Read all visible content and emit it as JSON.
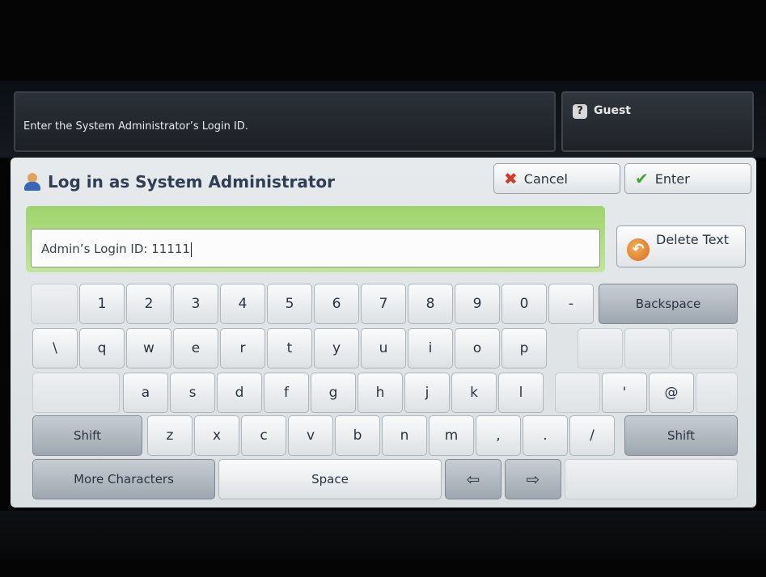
{
  "header": {
    "message": "Enter the System Administrator’s Login ID.",
    "user_icon_label": "?",
    "user": "Guest"
  },
  "dialog": {
    "title": "Log in as System Administrator",
    "cancel_label": "Cancel",
    "enter_label": "Enter",
    "delete_text_label": "Delete Text"
  },
  "input": {
    "label": "Admin’s Login ID: ",
    "value": "11111"
  },
  "keyboard": {
    "row1": [
      "1",
      "2",
      "3",
      "4",
      "5",
      "6",
      "7",
      "8",
      "9",
      "0",
      "-"
    ],
    "backspace": "Backspace",
    "row2": [
      "\\",
      "q",
      "w",
      "e",
      "r",
      "t",
      "y",
      "u",
      "i",
      "o",
      "p"
    ],
    "row3": [
      "a",
      "s",
      "d",
      "f",
      "g",
      "h",
      "j",
      "k",
      "l"
    ],
    "row3_extra": [
      "'",
      "@"
    ],
    "shift_left": "Shift",
    "row4": [
      "z",
      "x",
      "c",
      "v",
      "b",
      "n",
      "m",
      ",",
      ".",
      "/"
    ],
    "shift_right": "Shift",
    "more_characters": "More Characters",
    "space": "Space",
    "left_arrow": "⇦",
    "right_arrow": "⇨"
  },
  "icons": {
    "user_icon": "admin-user-icon",
    "cancel_icon": "x-icon",
    "enter_icon": "check-icon",
    "delete_icon": "undo-icon"
  }
}
